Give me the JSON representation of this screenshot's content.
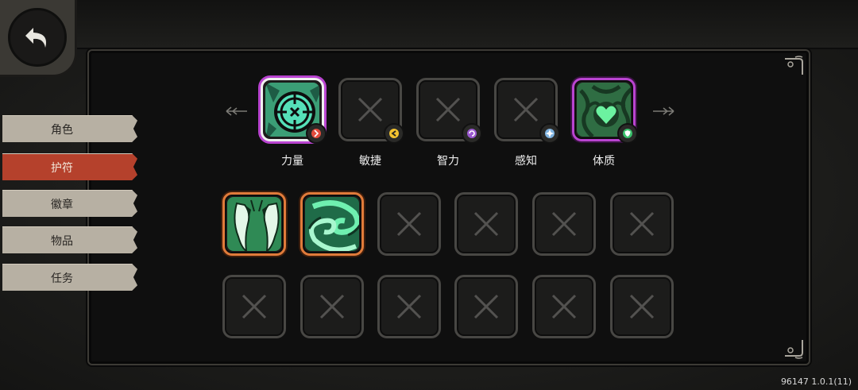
{
  "stats": [
    {
      "label": "力量",
      "state": "filled",
      "badge_color": "#e24b3c",
      "icon": "crosshair-emblem-icon"
    },
    {
      "label": "敏捷",
      "state": "empty",
      "badge_color": "#f2c230",
      "icon": "agility-badge-icon"
    },
    {
      "label": "智力",
      "state": "empty",
      "badge_color": "#9b59d0",
      "icon": "intellect-badge-icon"
    },
    {
      "label": "感知",
      "state": "empty",
      "badge_color": "#7fb3e0",
      "icon": "perception-badge-icon"
    },
    {
      "label": "体质",
      "state": "filled",
      "badge_color": "#39c06b",
      "icon": "heart-emblem-icon"
    }
  ],
  "tabs": [
    {
      "label": "角色",
      "active": false
    },
    {
      "label": "护符",
      "active": true
    },
    {
      "label": "徽章",
      "active": false
    },
    {
      "label": "物品",
      "active": false
    },
    {
      "label": "任务",
      "active": false
    }
  ],
  "inventory_row1": [
    "claws-charm-icon",
    "vortex-charm-icon",
    "empty",
    "empty",
    "empty",
    "empty"
  ],
  "inventory_row2": [
    "empty",
    "empty",
    "empty",
    "empty",
    "empty",
    "empty"
  ],
  "version": "96147 1.0.1(11)",
  "colors": {
    "accent_purple": "#b944d0",
    "accent_orange": "#e07b3a",
    "tab_active": "#b5412c",
    "tab_idle": "#b7b0a3",
    "charm_green": "#3fc27a"
  }
}
